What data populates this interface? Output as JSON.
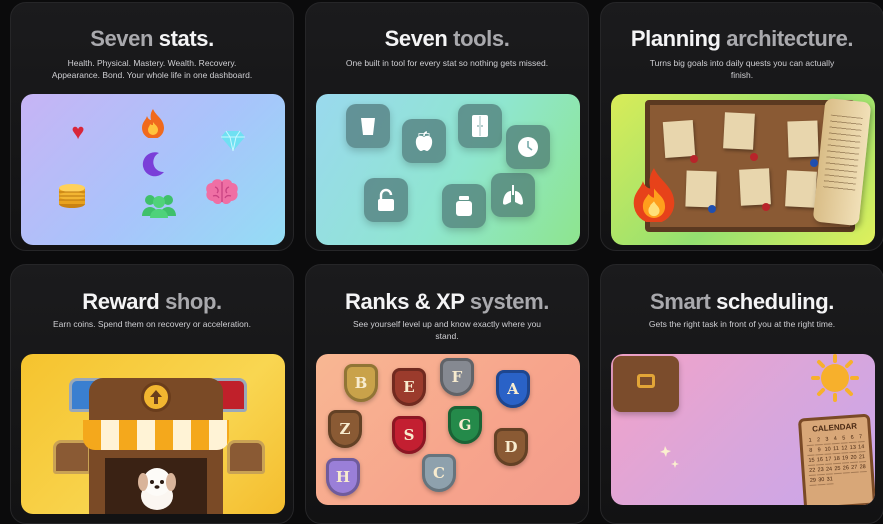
{
  "cards": [
    {
      "title_a": "Seven",
      "title_b": "stats.",
      "description": "Health. Physical. Mastery. Wealth. Recovery. Appearance. Bond. Your whole life in one dashboard."
    },
    {
      "title_a": "Seven",
      "title_b": "tools.",
      "description": "One built in tool for every stat so nothing gets missed."
    },
    {
      "title_a": "Planning",
      "title_b": "architecture.",
      "description": "Turns big goals into daily quests you can actually finish."
    },
    {
      "title_a": "Reward",
      "title_b": "shop.",
      "description": "Earn coins. Spend them on recovery or acceleration."
    },
    {
      "title_a": "Ranks & XP",
      "title_b": "system.",
      "description": "See yourself level up and know exactly where you stand."
    },
    {
      "title_a": "Smart",
      "title_b": "scheduling.",
      "description": "Gets the right task in front of you at the right time."
    }
  ],
  "ranks": [
    "B",
    "E",
    "F",
    "A",
    "Z",
    "S",
    "G",
    "D",
    "H",
    "C"
  ],
  "calendar_label": "CALENDAR",
  "calendar_days": [
    "1",
    "2",
    "3",
    "4",
    "5",
    "6",
    "7",
    "8",
    "9",
    "10",
    "11",
    "12",
    "13",
    "14",
    "15",
    "16",
    "17",
    "18",
    "19",
    "20",
    "21",
    "22",
    "23",
    "24",
    "25",
    "26",
    "27",
    "28",
    "29",
    "30",
    "31"
  ]
}
